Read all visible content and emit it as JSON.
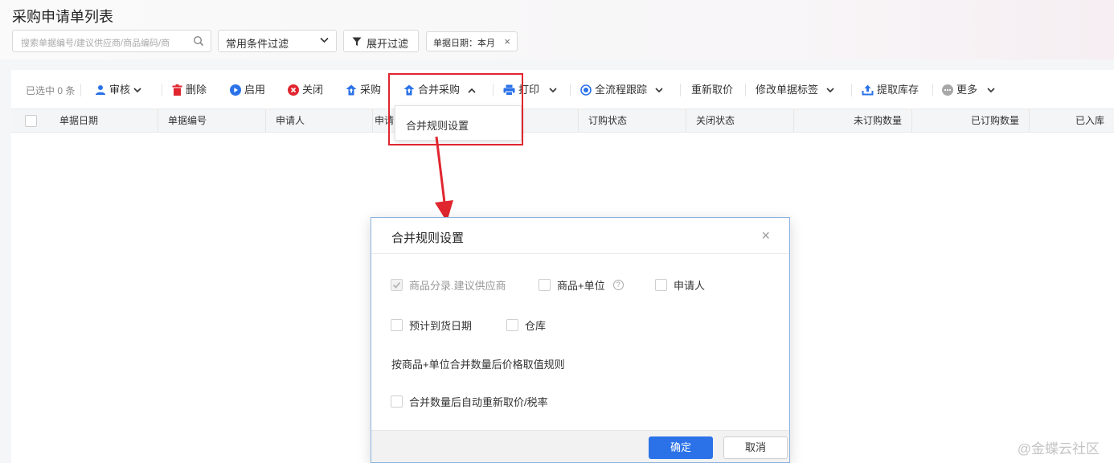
{
  "page": {
    "title": "采购申请单列表"
  },
  "search": {
    "placeholder": "搜索单据编号/建议供应商/商品编码/商"
  },
  "filter_select": {
    "value": "常用条件过滤"
  },
  "expand_filter": {
    "label": "展开过滤"
  },
  "filter_chip": {
    "label": "单据日期：本月",
    "close": "×"
  },
  "toolbar": {
    "selected_count": "已选中 0 条",
    "audit": "审核",
    "delete": "删除",
    "enable": "启用",
    "close": "关闭",
    "purchase": "采购",
    "merge_purchase": "合并采购",
    "print": "打印",
    "full_trace": "全流程跟踪",
    "reprice": "重新取价",
    "edit_tags": "修改单据标签",
    "fetch_stock": "提取库存",
    "more": "更多"
  },
  "table": {
    "columns": [
      "单据日期",
      "单据编号",
      "申请人",
      "申请",
      "订购状态",
      "关闭状态",
      "未订购数量",
      "已订购数量",
      "已入库"
    ]
  },
  "dropdown": {
    "option": "合并规则设置"
  },
  "dialog": {
    "title": "合并规则设置",
    "options_row1": [
      {
        "label": "商品分录.建议供应商",
        "checked": true,
        "disabled": true
      },
      {
        "label": "商品+单位",
        "checked": false,
        "help": "?"
      },
      {
        "label": "申请人",
        "checked": false
      }
    ],
    "options_row2": [
      {
        "label": "预计到货日期",
        "checked": false
      },
      {
        "label": "仓库",
        "checked": false
      }
    ],
    "rule_text": "按商品+单位合并数量后价格取值规则",
    "auto_reprice": {
      "label": "合并数量后自动重新取价/税率",
      "checked": false
    },
    "ok": "确定",
    "cancel": "取消"
  },
  "watermark": "@金蝶云社区",
  "colors": {
    "primary": "#2b72e8",
    "delete": "#e0262f",
    "highlight": "#e0262f"
  }
}
